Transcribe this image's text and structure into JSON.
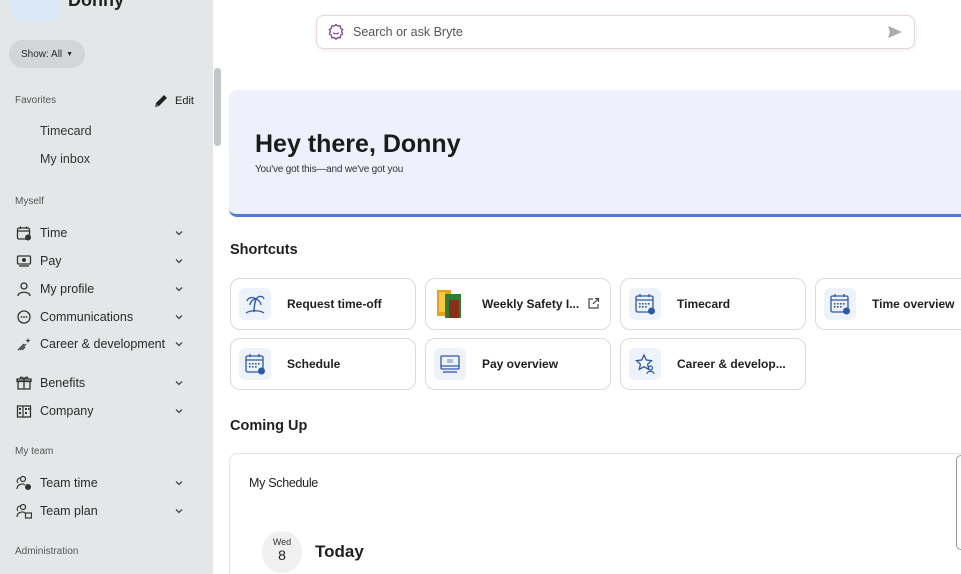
{
  "user": {
    "name": "Donny"
  },
  "sidebar": {
    "show_label": "Show: All",
    "favorites_label": "Favorites",
    "edit_label": "Edit",
    "favorites": [
      "Timecard",
      "My inbox"
    ],
    "myself_label": "Myself",
    "myself_items": [
      {
        "label": "Time",
        "icon": "calendar-clock-icon"
      },
      {
        "label": "Pay",
        "icon": "money-icon"
      },
      {
        "label": "My profile",
        "icon": "person-icon"
      },
      {
        "label": "Communications",
        "icon": "chat-icon"
      },
      {
        "label": "Career & development",
        "icon": "sparkle-growth-icon"
      },
      {
        "label": "Benefits",
        "icon": "gift-icon"
      },
      {
        "label": "Company",
        "icon": "building-icon"
      }
    ],
    "team_label": "My team",
    "team_items": [
      {
        "label": "Team time",
        "icon": "team-clock-icon"
      },
      {
        "label": "Team plan",
        "icon": "team-plan-icon"
      }
    ],
    "admin_label": "Administration"
  },
  "search": {
    "placeholder": "Search or ask Bryte"
  },
  "hero": {
    "title": "Hey there, Donny",
    "subtitle": "You've got this—and we've got you"
  },
  "shortcuts": {
    "heading": "Shortcuts",
    "items": [
      {
        "label": "Request time-off",
        "icon": "palm-tree-icon"
      },
      {
        "label": "Weekly Safety I...",
        "icon": "safety-logo-icon",
        "external": true
      },
      {
        "label": "Timecard",
        "icon": "calendar-clock-icon"
      },
      {
        "label": "Time overview",
        "icon": "calendar-clock-icon"
      },
      {
        "label": "Schedule",
        "icon": "calendar-clock-icon"
      },
      {
        "label": "Pay overview",
        "icon": "monitor-icon"
      },
      {
        "label": "Career & develop...",
        "icon": "star-person-icon"
      }
    ]
  },
  "coming_up": {
    "heading": "Coming Up",
    "card_title": "My Schedule",
    "day_name": "Wed",
    "day_number": "8",
    "day_label": "Today"
  },
  "colors": {
    "accent": "#4d7fd6",
    "sidebar_bg": "#e4e7e8",
    "hero_bg": "#eef1fb",
    "search_icon": "#7b3fa0"
  }
}
